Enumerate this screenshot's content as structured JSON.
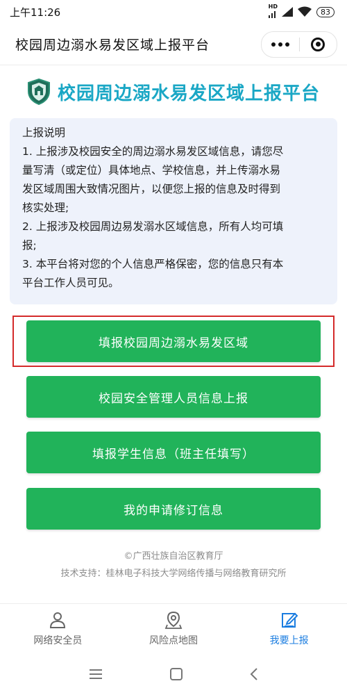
{
  "status_bar": {
    "time": "上午11:26",
    "network": "HD",
    "battery": "83"
  },
  "title_bar": {
    "title": "校园周边溺水易发区域上报平台"
  },
  "brand": {
    "title": "校园周边溺水易发区域上报平台",
    "color": "#1aa7c5"
  },
  "notice": {
    "heading": "上报说明",
    "lines": [
      "1. 上报涉及校园安全的周边溺水易发区域信息，请您尽",
      "量写清（或定位）具体地点、学校信息，并上传溺水易",
      "发区域周围大致情况图片，以便您上报的信息及时得到",
      "核实处理;",
      "2. 上报涉及校园周边易发溺水区域信息，所有人均可填",
      "报;",
      "3. 本平台将对您的个人信息严格保密，您的信息只有本",
      "平台工作人员可见。"
    ]
  },
  "buttons": [
    {
      "label": "填报校园周边溺水易发区域"
    },
    {
      "label": "校园安全管理人员信息上报"
    },
    {
      "label": "填报学生信息（班主任填写）"
    },
    {
      "label": "我的申请修订信息"
    }
  ],
  "footer": {
    "copyright": "©广西壮族自治区教育厅",
    "support": "技术支持：桂林电子科技大学网络传播与网络教育研究所"
  },
  "tabs": [
    {
      "label": "网络安全员",
      "icon": "person-icon"
    },
    {
      "label": "风险点地图",
      "icon": "map-pin-icon"
    },
    {
      "label": "我要上报",
      "icon": "edit-icon",
      "active": true
    }
  ],
  "colors": {
    "primary_button": "#21b35a",
    "highlight_border": "#d42a2a",
    "active_tab": "#1b7de0"
  }
}
